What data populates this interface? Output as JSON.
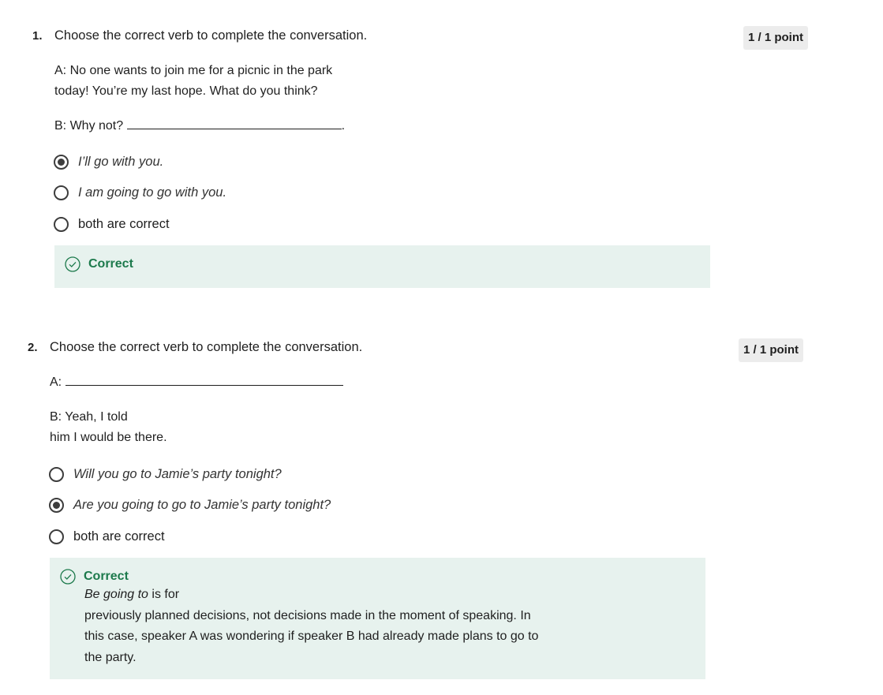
{
  "questions": [
    {
      "number": "1.",
      "prompt": "Choose the correct verb to complete the conversation.",
      "points": "1 / 1 point",
      "line_a1": "A: No one wants to join me for a picnic in the park",
      "line_a2": "today!  You’re my last hope.  What do you think?",
      "line_b": "B: Why not?",
      "line_b_end": ".",
      "options": [
        {
          "label": "I’ll go with you.",
          "selected": true
        },
        {
          "label": "I am going to go with you.",
          "selected": false
        },
        {
          "label": "both are correct",
          "selected": false
        }
      ],
      "feedback": {
        "title": "Correct"
      }
    },
    {
      "number": "2.",
      "prompt": "Choose the correct verb to complete the conversation.",
      "points": "1 / 1 point",
      "line_a": "A:",
      "line_b1": "B: Yeah, I told",
      "line_b2": "him I would be there.",
      "options": [
        {
          "label": "Will you go to Jamie’s party tonight?",
          "selected": false
        },
        {
          "label": "Are you going to go to Jamie’s party tonight?",
          "selected": true
        },
        {
          "label": "both are correct",
          "selected": false
        }
      ],
      "feedback": {
        "title": "Correct",
        "emph": "Be going to",
        "line1_rest": " is for",
        "line2": "previously planned decisions, not decisions made in the moment of speaking. In",
        "line3": "this case, speaker A was wondering if speaker B had already made plans to go to",
        "line4": "the party."
      }
    }
  ],
  "colors": {
    "correct": "#1d7a4c",
    "feedback_bg": "#e7f2ee",
    "points_bg": "#ececec"
  }
}
